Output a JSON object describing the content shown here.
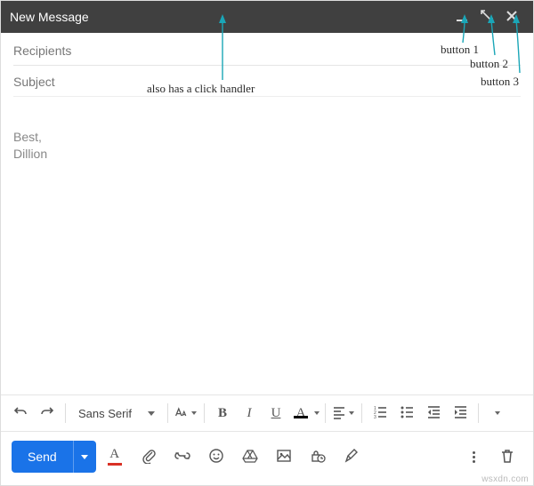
{
  "header": {
    "title": "New Message"
  },
  "fields": {
    "recipients_placeholder": "Recipients",
    "subject_placeholder": "Subject"
  },
  "body": {
    "signature_line1": "Best,",
    "signature_line2": "Dillion"
  },
  "toolbar": {
    "font_family": "Sans Serif",
    "bold_glyph": "B",
    "italic_glyph": "I",
    "underline_glyph": "U",
    "text_color_glyph": "A"
  },
  "bottom": {
    "send_label": "Send",
    "format_glyph": "A"
  },
  "annotations": {
    "header_click": "also has a click handler",
    "btn1": "button 1",
    "btn2": "button 2",
    "btn3": "button 3"
  },
  "watermark": "wsxdn.com"
}
